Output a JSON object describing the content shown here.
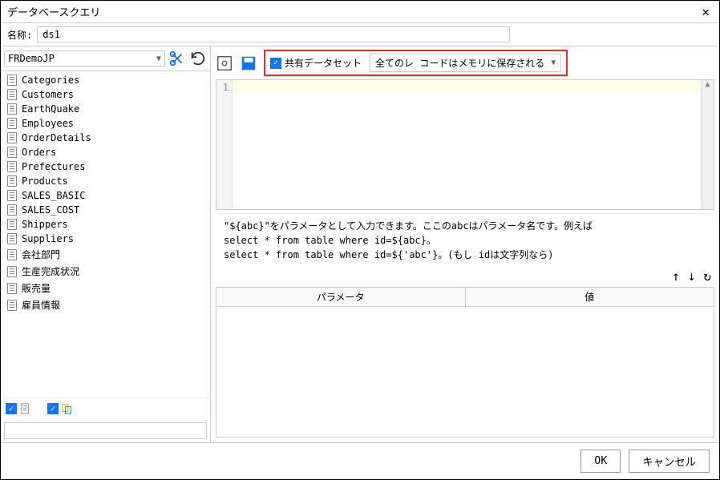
{
  "window": {
    "title": "データベースクエリ"
  },
  "name": {
    "label": "名称:",
    "value": "ds1"
  },
  "db": {
    "selected": "FRDemoJP"
  },
  "tables": [
    "Categories",
    "Customers",
    "EarthQuake",
    "Employees",
    "OrderDetails",
    "Orders",
    "Prefectures",
    "Products",
    "SALES_BASIC",
    "SALES_COST",
    "Shippers",
    "Suppliers",
    "会社部門",
    "生産完成状況",
    "販売量",
    "雇員情報"
  ],
  "left_search": {
    "placeholder": ""
  },
  "toolbar": {
    "shared_label": "共有データセット",
    "memory_mode": "全てのレ コードはメモリに保存される"
  },
  "editor": {
    "line1": "1"
  },
  "hint": {
    "l1": "\"${abc}\"をパラメータとして入力できます。ここのabcはパラメータ名です。例えば",
    "l2": "select * from table where id=${abc}。",
    "l3": "select * from table where id=${'abc'}。(もし idは文字列なら)"
  },
  "param": {
    "header_name": "パラメータ",
    "header_value": "値"
  },
  "buttons": {
    "ok": "OK",
    "cancel": "キャンセル"
  }
}
